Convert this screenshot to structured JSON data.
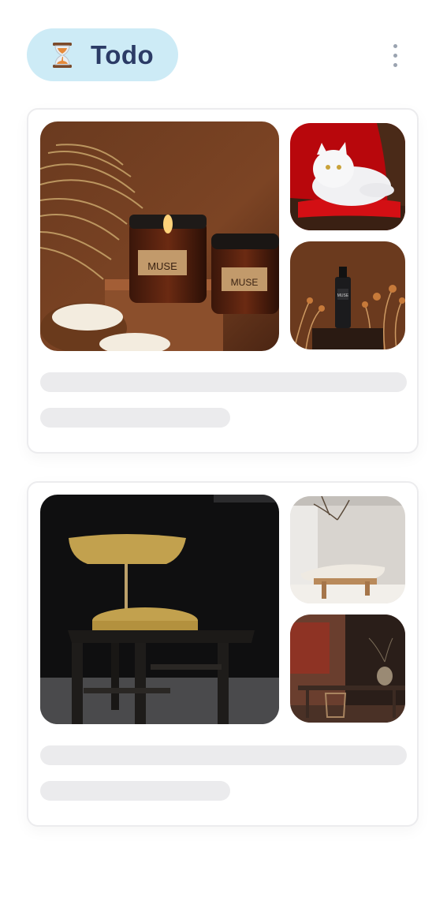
{
  "header": {
    "title": "Todo",
    "title_icon": "hourglass-icon",
    "menu_icon": "more-vertical-icon",
    "pill_color": "#cdebf6",
    "title_color": "#2b3b66"
  },
  "cards": [
    {
      "images": [
        {
          "name": "candle-jars-photo",
          "content": "MUSE",
          "subcontent": "MUSE"
        },
        {
          "name": "white-cat-photo"
        },
        {
          "name": "perfume-bottle-photo",
          "content": "MUSE"
        }
      ],
      "skeleton_lines": 2
    },
    {
      "images": [
        {
          "name": "velvet-chair-photo"
        },
        {
          "name": "stone-bench-photo"
        },
        {
          "name": "dining-room-photo"
        }
      ],
      "skeleton_lines": 2
    }
  ],
  "skeleton_color": "#ebebed"
}
